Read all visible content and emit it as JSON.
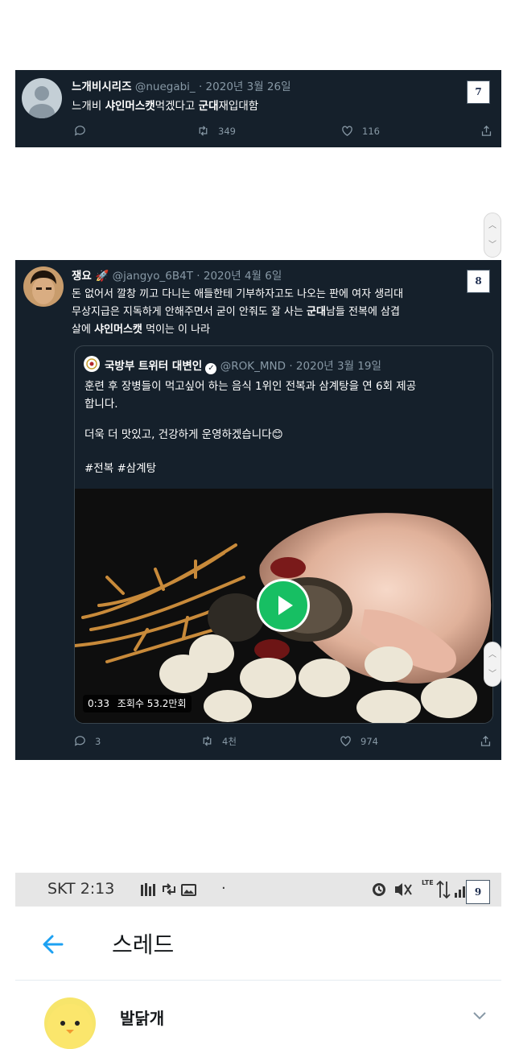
{
  "tweet7": {
    "name": "느개비시리즈",
    "handle": "@nuegabi_",
    "date": "· 2020년 3월 26일",
    "text_prefix": "느개비 ",
    "text_bold1": "샤인머스캣",
    "text_mid": "먹겠다고 ",
    "text_bold2": "군대",
    "text_suffix": "재입대함",
    "retweets": "349",
    "likes": "116",
    "badge": "7"
  },
  "tweet8": {
    "name": "쟁요 🚀",
    "handle": "@jangyo_6B4T",
    "date": "· 2020년 4월 6일",
    "line1": "돈 없어서 깔창 끼고 다니는 애들한테 기부하자고도 나오는 판에 여자 생리대",
    "line2_prefix": "무상지급은 지독하게 안해주면서 굳이 안줘도 잘 사는 ",
    "line2_bold": "군대",
    "line2_suffix": "남들 전복에 삼겹",
    "line3_prefix": "살에 ",
    "line3_bold": "샤인머스캣",
    "line3_suffix": " 먹이는 이 나라",
    "replies": "3",
    "retweets": "4천",
    "likes": "974",
    "badge": "8",
    "quote": {
      "name": "국방부 트위터 대변인",
      "handle": "@ROK_MND",
      "date": "· 2020년 3월 19일",
      "line1": "훈련 후 장병들이 먹고싶어 하는 음식 1위인 전복과 삼계탕을 연 6회 제공",
      "line2": "합니다.",
      "line3": "더욱 더 맛있고, 건강하게 운영하겠습니다😊",
      "hashtags": "#전복 #삼계탕",
      "video_time": "0:33",
      "video_views": "조회수 53.2만회"
    }
  },
  "phone": {
    "status_carrier_time": "SKT 2:13",
    "status_dot": "·",
    "lte": "LTE",
    "badge": "9",
    "header_title": "스레드",
    "first_user": "발닭개"
  },
  "colors": {
    "panel_bg": "#15202b",
    "muted": "#8899a6",
    "accent": "#1da1f2",
    "play": "#17bf63"
  }
}
